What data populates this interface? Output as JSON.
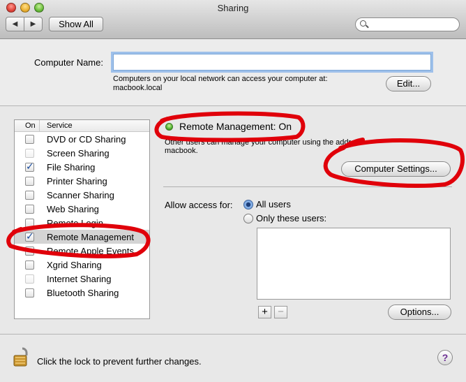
{
  "window": {
    "title": "Sharing"
  },
  "toolbar": {
    "back_icon": "◀",
    "forward_icon": "▶",
    "show_all_label": "Show All",
    "search_placeholder": ""
  },
  "computer_name": {
    "label": "Computer Name:",
    "value": "",
    "help_line1": "Computers on your local network can access your computer at:",
    "help_line2": "macbook.local",
    "edit_label": "Edit..."
  },
  "services": {
    "header_on": "On",
    "header_service": "Service",
    "items": [
      {
        "name": "DVD or CD Sharing",
        "checked": false,
        "enabled": true
      },
      {
        "name": "Screen Sharing",
        "checked": false,
        "enabled": false
      },
      {
        "name": "File Sharing",
        "checked": true,
        "enabled": true
      },
      {
        "name": "Printer Sharing",
        "checked": false,
        "enabled": true
      },
      {
        "name": "Scanner Sharing",
        "checked": false,
        "enabled": true
      },
      {
        "name": "Web Sharing",
        "checked": false,
        "enabled": true
      },
      {
        "name": "Remote Login",
        "checked": false,
        "enabled": true
      },
      {
        "name": "Remote Management",
        "checked": true,
        "enabled": true,
        "selected": true
      },
      {
        "name": "Remote Apple Events",
        "checked": false,
        "enabled": true
      },
      {
        "name": "Xgrid Sharing",
        "checked": false,
        "enabled": true
      },
      {
        "name": "Internet Sharing",
        "checked": false,
        "enabled": false
      },
      {
        "name": "Bluetooth Sharing",
        "checked": false,
        "enabled": true
      }
    ]
  },
  "detail": {
    "status": "Remote Management: On",
    "status_color": "#4fb02e",
    "description_line1": "Other users can manage your computer using the address",
    "description_line2": "macbook.",
    "computer_settings_label": "Computer Settings...",
    "allow_access_label": "Allow access for:",
    "all_users_label": "All users",
    "only_these_label": "Only these users:",
    "all_users_selected": true,
    "plus_label": "+",
    "minus_label": "−",
    "options_label": "Options..."
  },
  "footer": {
    "lock_text": "Click the lock to prevent further changes.",
    "help_label": "?"
  },
  "annotation_color": "#e0000a"
}
